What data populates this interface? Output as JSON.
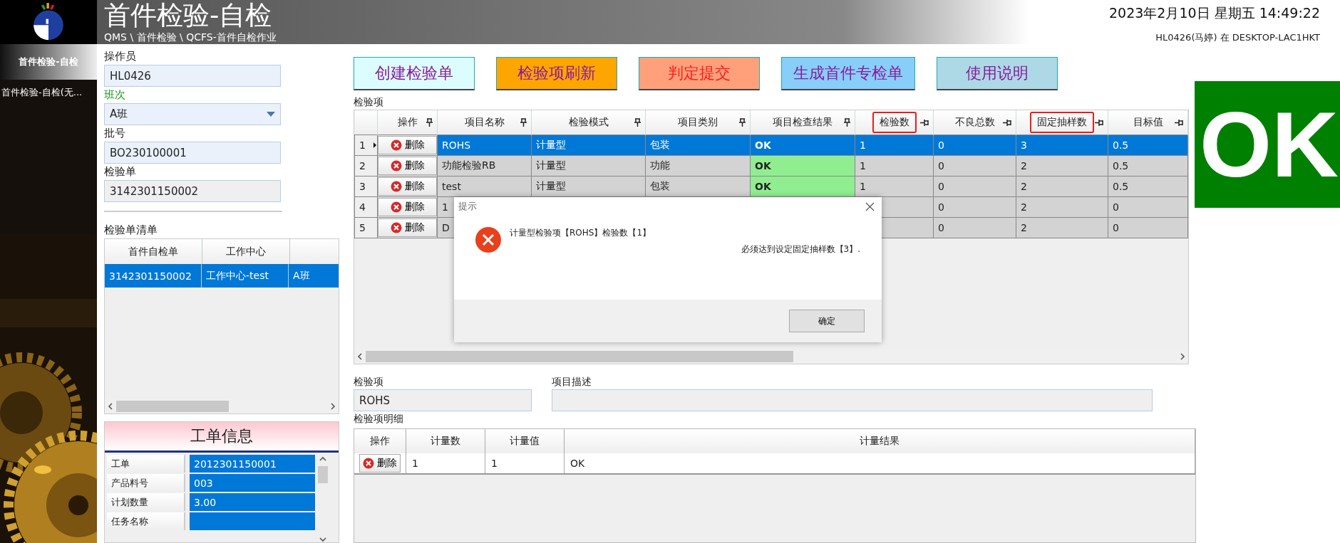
{
  "header": {
    "title": "首件检验-自检",
    "breadcrumb": "QMS \\ 首件检验 \\ QCFS-首件自检作业",
    "datetime": "2023年2月10日 星期五 14:49:22",
    "user": "HL0426(马婷) 在 DESKTOP-LAC1HKT"
  },
  "sidebar": {
    "items": [
      {
        "label": "首件检验-自检",
        "selected": true
      },
      {
        "label": "首件检验-自检(无...",
        "selected": false
      }
    ]
  },
  "form": {
    "fields": [
      {
        "label": "操作员",
        "value": "HL0426",
        "kind": "text"
      },
      {
        "label": "班次",
        "value": "A班",
        "kind": "select"
      },
      {
        "label": "批号",
        "value": "BO230100001",
        "kind": "text"
      },
      {
        "label": "检验单",
        "value": "3142301150002",
        "kind": "readonly"
      }
    ]
  },
  "order_list": {
    "title": "检验单清单",
    "columns": [
      "首件自检单",
      "工作中心"
    ],
    "rows": [
      {
        "cells": [
          "3142301150002",
          "工作中心-test",
          "A班"
        ],
        "selected": true
      }
    ]
  },
  "work_order": {
    "title": "工单信息",
    "rows": [
      {
        "label": "工单",
        "value": "2012301150001"
      },
      {
        "label": "产品料号",
        "value": "003"
      },
      {
        "label": "计划数量",
        "value": "3.00"
      },
      {
        "label": "任务名称"
      }
    ]
  },
  "toolbar": [
    {
      "label": "创建检验单",
      "color": "#dcfdfd",
      "kind": "action"
    },
    {
      "label": "检验项刷新",
      "color": "#ffa500",
      "kind": "action"
    },
    {
      "label": "判定提交",
      "color": "#ffa07a",
      "kind": "submit"
    },
    {
      "label": "生成首件专检单",
      "color": "#87cefa",
      "kind": "action"
    },
    {
      "label": "使用说明",
      "color": "#add8e6",
      "kind": "action"
    }
  ],
  "items_table": {
    "title": "检验项",
    "columns": [
      {
        "label": "操作",
        "pinned": true,
        "highlighted": false
      },
      {
        "label": "项目名称",
        "pinned": true,
        "highlighted": false
      },
      {
        "label": "检验模式",
        "pinned": true,
        "highlighted": false
      },
      {
        "label": "项目类别",
        "pinned": true,
        "highlighted": false
      },
      {
        "label": "项目检查结果",
        "pinned": true,
        "highlighted": false
      },
      {
        "label": "检验数",
        "pinned": false,
        "highlighted": true
      },
      {
        "label": "不良总数",
        "pinned": false,
        "highlighted": false
      },
      {
        "label": "固定抽样数",
        "pinned": false,
        "highlighted": true
      },
      {
        "label": "目标值",
        "pinned": false,
        "highlighted": false
      }
    ],
    "rows": [
      {
        "no": "1",
        "selected": true,
        "cells": [
          "删除",
          "ROHS",
          "计量型",
          "包装",
          "OK",
          "1",
          "0",
          "3",
          "0.5"
        ]
      },
      {
        "no": "2",
        "selected": false,
        "cells": [
          "删除",
          "功能检验RB",
          "计量型",
          "功能",
          "OK",
          "1",
          "0",
          "2",
          "0.5"
        ]
      },
      {
        "no": "3",
        "selected": false,
        "cells": [
          "删除",
          "test",
          "计量型",
          "包装",
          "OK",
          "1",
          "0",
          "2",
          "0.5"
        ]
      },
      {
        "no": "4",
        "selected": false,
        "cells": [
          "删除",
          "1",
          null,
          null,
          null,
          null,
          "0",
          "2",
          "0"
        ]
      },
      {
        "no": "5",
        "selected": false,
        "cells": [
          "删除",
          "D",
          null,
          null,
          null,
          null,
          "0",
          "2",
          "0"
        ]
      }
    ]
  },
  "status_badge": {
    "text": "OK"
  },
  "detail_fields": [
    {
      "label": "检验项",
      "value": "ROHS"
    },
    {
      "label": "项目描述"
    }
  ],
  "detail_table": {
    "title": "检验项明细",
    "columns": [
      "操作",
      "计量数",
      "计量值",
      "计量结果"
    ],
    "rows": [
      {
        "action": "删除",
        "cells": [
          "1",
          "1",
          "OK"
        ]
      }
    ]
  },
  "dialog": {
    "title": "提示",
    "line_1": "计量型检验项【ROHS】检验数【1】",
    "line_2": "必须达到设定固定抽样数【3】.",
    "button": "确定"
  }
}
